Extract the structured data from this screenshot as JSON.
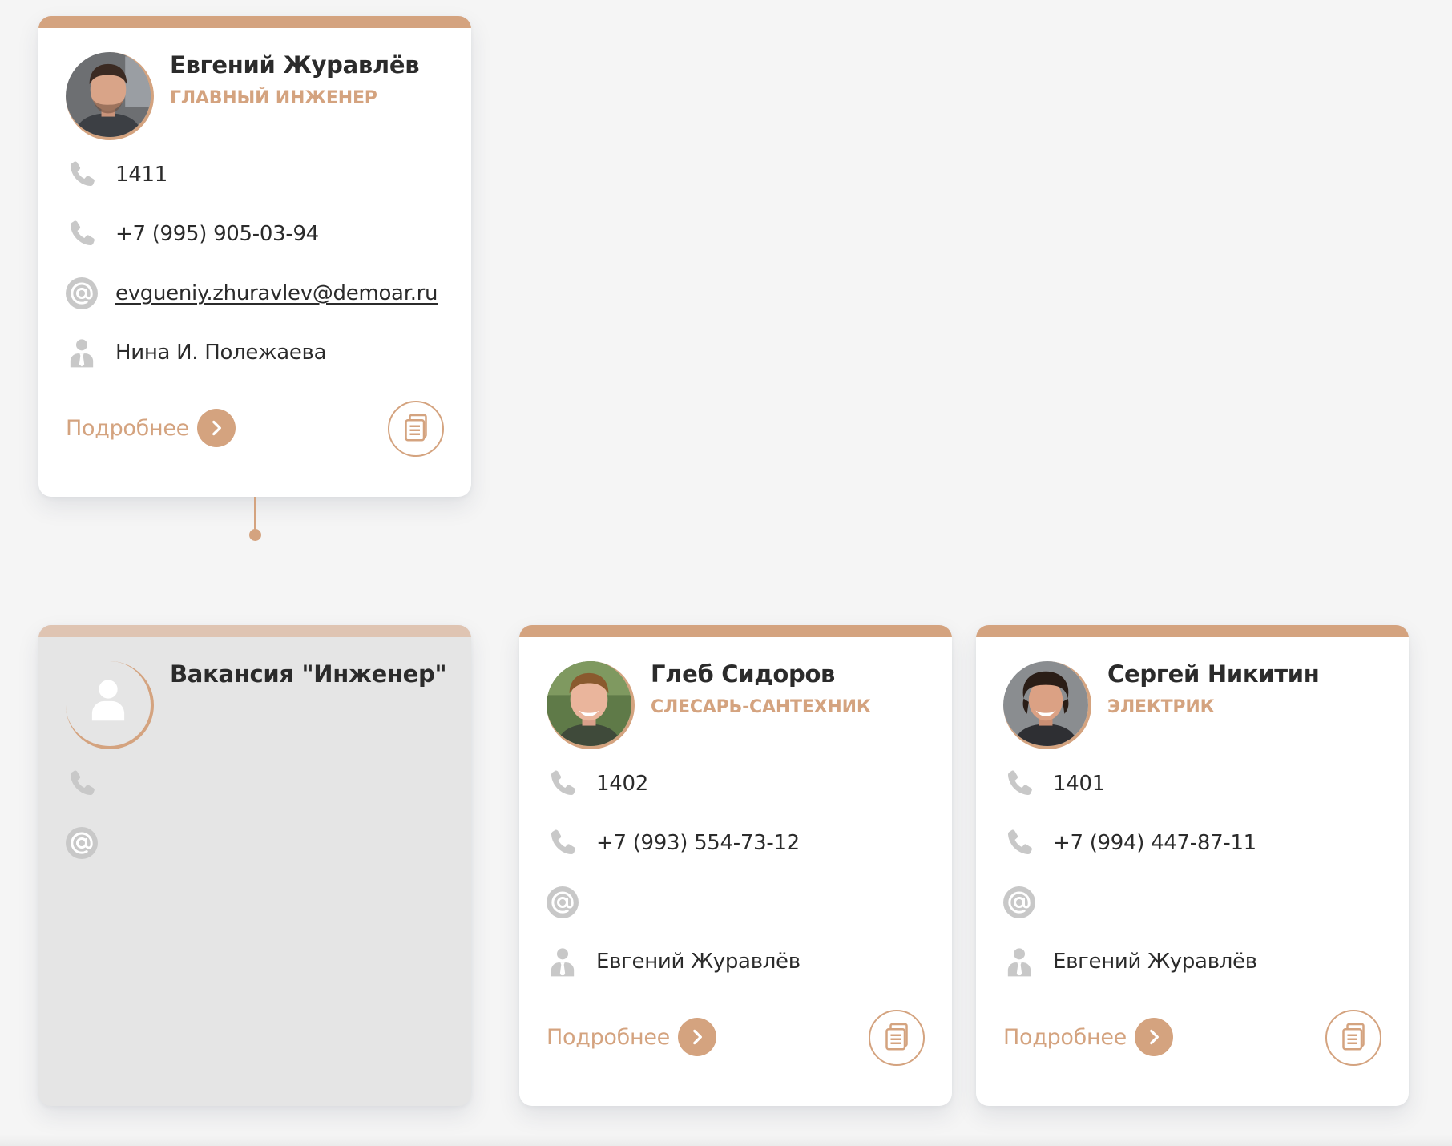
{
  "accent_color": "#d4a37f",
  "icons": {
    "phone": "phone-icon",
    "email": "at-sign-icon",
    "manager": "person-icon",
    "more_arrow": "chevron-right-icon",
    "documents": "documents-icon"
  },
  "cards": [
    {
      "name": "Евгений Журавлёв",
      "position": "Главный инженер",
      "internal_phone": "1411",
      "mobile_phone": "+7 (995) 905-03-94",
      "email": "evgueniy.zhuravlev@demoar.ru",
      "manager": "Нина И. Полежаева",
      "more_label": "Подробнее"
    },
    {
      "name": "Вакансия \"Инженер\""
    },
    {
      "name": "Глеб Сидоров",
      "position": "Слесарь-сантехник",
      "internal_phone": "1402",
      "mobile_phone": "+7 (993) 554-73-12",
      "manager": "Евгений Журавлёв",
      "more_label": "Подробнее"
    },
    {
      "name": "Сергей Никитин",
      "position": "Электрик",
      "internal_phone": "1401",
      "mobile_phone": "+7 (994) 447-87-11",
      "manager": "Евгений Журавлёв",
      "more_label": "Подробнее"
    }
  ]
}
